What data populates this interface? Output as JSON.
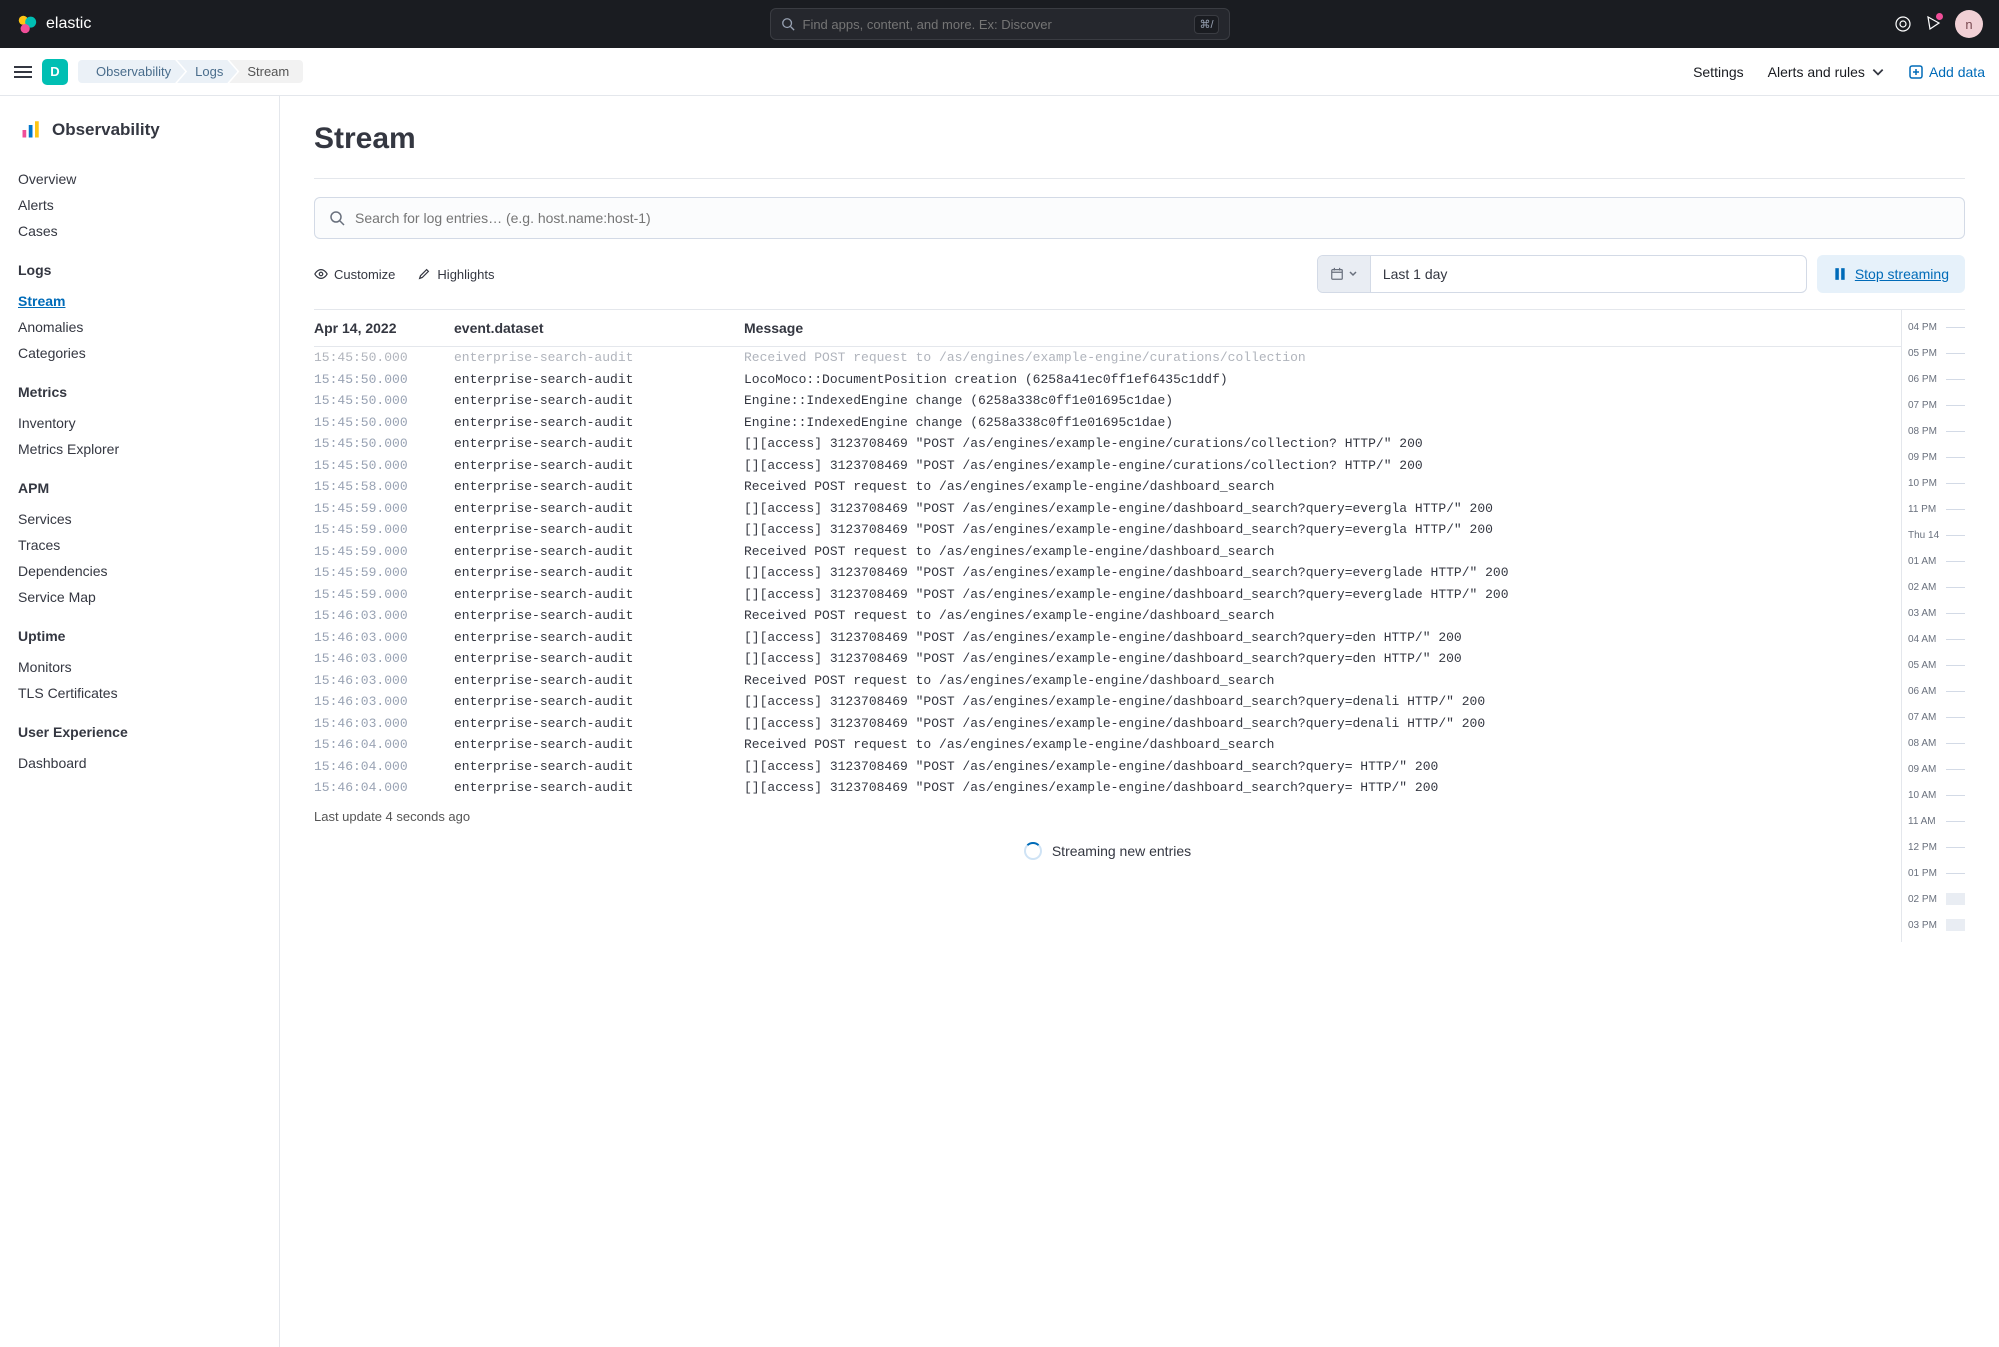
{
  "brand": "elastic",
  "global_search_placeholder": "Find apps, content, and more. Ex: Discover",
  "global_search_kbd": "⌘/",
  "avatar_initial": "n",
  "space_initial": "D",
  "breadcrumbs": [
    "Observability",
    "Logs",
    "Stream"
  ],
  "topnav": {
    "settings": "Settings",
    "alerts": "Alerts and rules",
    "add_data": "Add data"
  },
  "sidebar": {
    "title": "Observability",
    "top": [
      "Overview",
      "Alerts",
      "Cases"
    ],
    "sections": [
      {
        "heading": "Logs",
        "items": [
          "Stream",
          "Anomalies",
          "Categories"
        ],
        "active": "Stream"
      },
      {
        "heading": "Metrics",
        "items": [
          "Inventory",
          "Metrics Explorer"
        ]
      },
      {
        "heading": "APM",
        "items": [
          "Services",
          "Traces",
          "Dependencies",
          "Service Map"
        ]
      },
      {
        "heading": "Uptime",
        "items": [
          "Monitors",
          "TLS Certificates"
        ]
      },
      {
        "heading": "User Experience",
        "items": [
          "Dashboard"
        ]
      }
    ]
  },
  "page_title": "Stream",
  "log_search_placeholder": "Search for log entries… (e.g. host.name:host-1)",
  "toolbar": {
    "customize": "Customize",
    "highlights": "Highlights",
    "date_range": "Last 1 day",
    "stop": "Stop streaming"
  },
  "columns": {
    "ts": "Apr 14, 2022",
    "ds": "event.dataset",
    "msg": "Message"
  },
  "logs": [
    {
      "ts": "15:45:50.000",
      "ds": "enterprise-search-audit",
      "msg": "Received POST request to /as/engines/example-engine/curations/collection",
      "dim": true
    },
    {
      "ts": "15:45:50.000",
      "ds": "enterprise-search-audit",
      "msg": "LocoMoco::DocumentPosition creation (6258a41ec0ff1ef6435c1ddf)"
    },
    {
      "ts": "15:45:50.000",
      "ds": "enterprise-search-audit",
      "msg": "Engine::IndexedEngine change (6258a338c0ff1e01695c1dae)"
    },
    {
      "ts": "15:45:50.000",
      "ds": "enterprise-search-audit",
      "msg": "Engine::IndexedEngine change (6258a338c0ff1e01695c1dae)"
    },
    {
      "ts": "15:45:50.000",
      "ds": "enterprise-search-audit",
      "msg": "[][access]  3123708469 \"POST /as/engines/example-engine/curations/collection? HTTP/\" 200"
    },
    {
      "ts": "15:45:50.000",
      "ds": "enterprise-search-audit",
      "msg": "[][access]  3123708469 \"POST /as/engines/example-engine/curations/collection? HTTP/\" 200"
    },
    {
      "ts": "15:45:58.000",
      "ds": "enterprise-search-audit",
      "msg": "Received POST request to /as/engines/example-engine/dashboard_search"
    },
    {
      "ts": "15:45:59.000",
      "ds": "enterprise-search-audit",
      "msg": "[][access]  3123708469 \"POST /as/engines/example-engine/dashboard_search?query=evergla HTTP/\" 200"
    },
    {
      "ts": "15:45:59.000",
      "ds": "enterprise-search-audit",
      "msg": "[][access]  3123708469 \"POST /as/engines/example-engine/dashboard_search?query=evergla HTTP/\" 200"
    },
    {
      "ts": "15:45:59.000",
      "ds": "enterprise-search-audit",
      "msg": "Received POST request to /as/engines/example-engine/dashboard_search"
    },
    {
      "ts": "15:45:59.000",
      "ds": "enterprise-search-audit",
      "msg": "[][access]  3123708469 \"POST /as/engines/example-engine/dashboard_search?query=everglade HTTP/\" 200"
    },
    {
      "ts": "15:45:59.000",
      "ds": "enterprise-search-audit",
      "msg": "[][access]  3123708469 \"POST /as/engines/example-engine/dashboard_search?query=everglade HTTP/\" 200"
    },
    {
      "ts": "15:46:03.000",
      "ds": "enterprise-search-audit",
      "msg": "Received POST request to /as/engines/example-engine/dashboard_search"
    },
    {
      "ts": "15:46:03.000",
      "ds": "enterprise-search-audit",
      "msg": "[][access]  3123708469 \"POST /as/engines/example-engine/dashboard_search?query=den HTTP/\" 200"
    },
    {
      "ts": "15:46:03.000",
      "ds": "enterprise-search-audit",
      "msg": "[][access]  3123708469 \"POST /as/engines/example-engine/dashboard_search?query=den HTTP/\" 200"
    },
    {
      "ts": "15:46:03.000",
      "ds": "enterprise-search-audit",
      "msg": "Received POST request to /as/engines/example-engine/dashboard_search"
    },
    {
      "ts": "15:46:03.000",
      "ds": "enterprise-search-audit",
      "msg": "[][access]  3123708469 \"POST /as/engines/example-engine/dashboard_search?query=denali HTTP/\" 200"
    },
    {
      "ts": "15:46:03.000",
      "ds": "enterprise-search-audit",
      "msg": "[][access]  3123708469 \"POST /as/engines/example-engine/dashboard_search?query=denali HTTP/\" 200"
    },
    {
      "ts": "15:46:04.000",
      "ds": "enterprise-search-audit",
      "msg": "Received POST request to /as/engines/example-engine/dashboard_search"
    },
    {
      "ts": "15:46:04.000",
      "ds": "enterprise-search-audit",
      "msg": "[][access]  3123708469 \"POST /as/engines/example-engine/dashboard_search?query= HTTP/\" 200"
    },
    {
      "ts": "15:46:04.000",
      "ds": "enterprise-search-audit",
      "msg": "[][access]  3123708469 \"POST /as/engines/example-engine/dashboard_search?query= HTTP/\" 200"
    }
  ],
  "last_update": "Last update 4 seconds ago",
  "streaming_label": "Streaming new entries",
  "minimap": [
    "04 PM",
    "05 PM",
    "06 PM",
    "07 PM",
    "08 PM",
    "09 PM",
    "10 PM",
    "11 PM",
    "Thu 14",
    "01 AM",
    "02 AM",
    "03 AM",
    "04 AM",
    "05 AM",
    "06 AM",
    "07 AM",
    "08 AM",
    "09 AM",
    "10 AM",
    "11 AM",
    "12 PM",
    "01 PM",
    "02 PM",
    "03 PM"
  ]
}
